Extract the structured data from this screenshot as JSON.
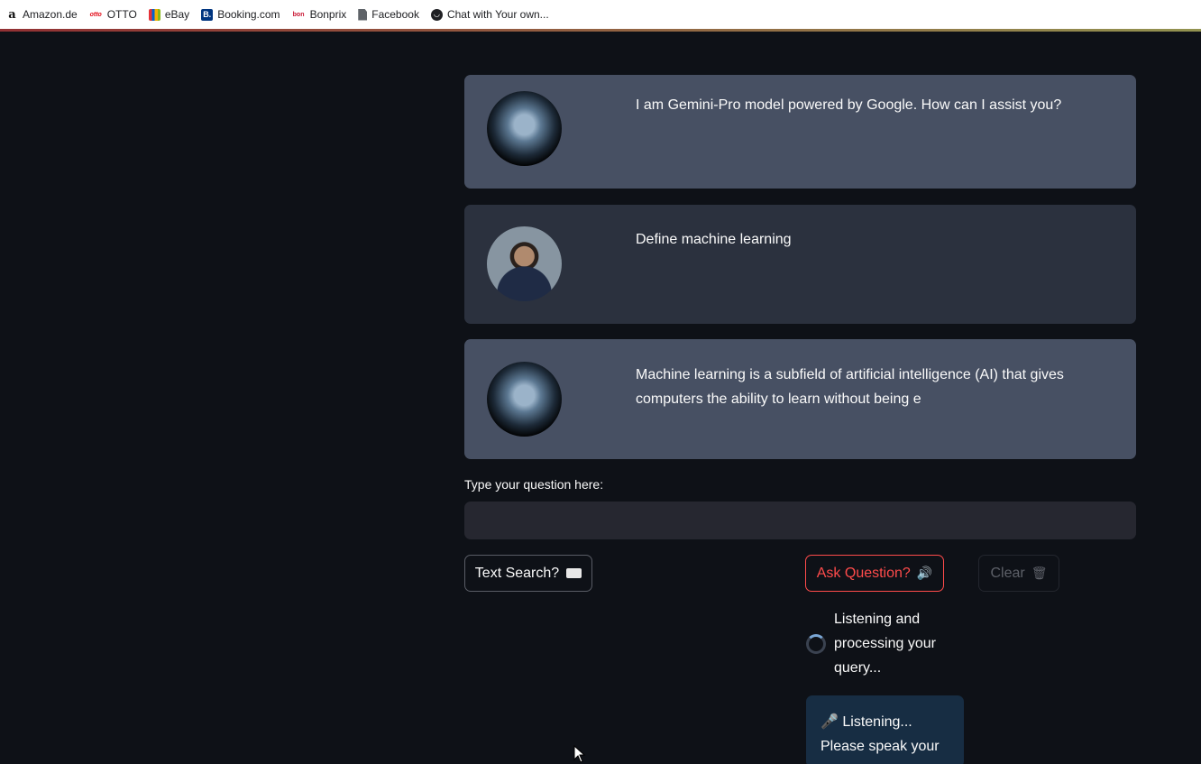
{
  "bookmarks": [
    {
      "label": "Amazon.de",
      "icon": "amazon-icon"
    },
    {
      "label": "OTTO",
      "icon": "otto-icon"
    },
    {
      "label": "eBay",
      "icon": "ebay-icon"
    },
    {
      "label": "Booking.com",
      "icon": "booking-icon"
    },
    {
      "label": "Bonprix",
      "icon": "bonprix-icon"
    },
    {
      "label": "Facebook",
      "icon": "document-icon"
    },
    {
      "label": "Chat with Your own...",
      "icon": "chat-icon"
    }
  ],
  "messages": [
    {
      "role": "assistant",
      "avatar": "robot-avatar",
      "text": "I am Gemini-Pro model powered by Google. How can I assist you?"
    },
    {
      "role": "user",
      "avatar": "user-avatar",
      "text": "Define machine learning"
    },
    {
      "role": "assistant",
      "avatar": "robot-avatar",
      "text": "Machine learning is a subfield of artificial intelligence (AI) that gives computers the ability to learn without being e"
    }
  ],
  "input": {
    "label": "Type your question here:",
    "value": ""
  },
  "buttons": {
    "text_search": "Text Search?",
    "ask_question": "Ask Question?",
    "clear": "Clear"
  },
  "status": {
    "spinner_text": "Listening and processing your query...",
    "info_text": "🎤 Listening... Please speak your"
  },
  "colors": {
    "background": "#0e1117",
    "assistant_message": "#475063",
    "user_message": "#2b313e",
    "accent": "#ff4b4b",
    "info_box": "#172d43"
  }
}
